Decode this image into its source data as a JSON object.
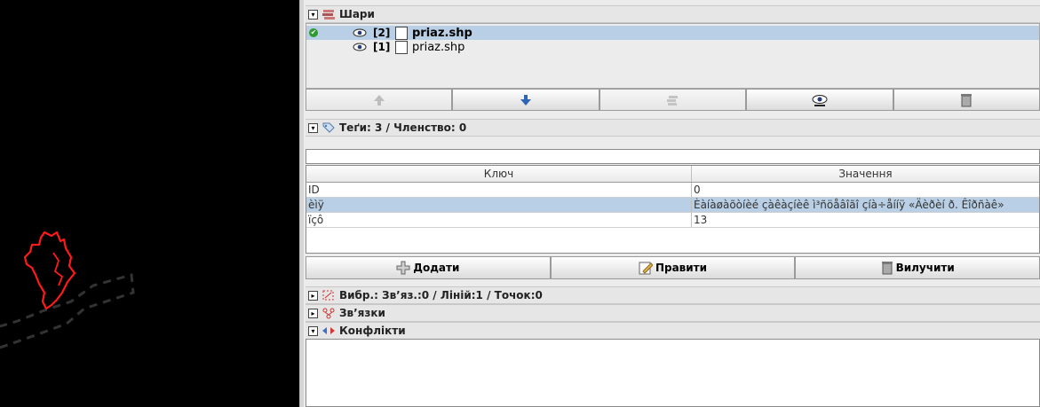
{
  "layers_panel": {
    "title": "Шари",
    "layers": [
      {
        "index": "[2]",
        "name": "priaz.shp",
        "active": true,
        "selected": true
      },
      {
        "index": "[1]",
        "name": "priaz.shp",
        "active": false,
        "selected": false
      }
    ],
    "buttons": [
      "move-up-icon",
      "move-down-icon",
      "merge-icon",
      "visibility-icon",
      "delete-icon"
    ]
  },
  "tags_panel": {
    "title": "Теґи: 3 / Членство: 0",
    "filter_value": "",
    "columns": {
      "key": "Ключ",
      "value": "Значення"
    },
    "rows": [
      {
        "key": "ID",
        "value": "0"
      },
      {
        "key": "èìÿ",
        "value": "Èàíàøàõòíèé çàêàçíèê ì³ñöåâîãî çíà÷åííÿ «Äèðèí ð. Êîðñàê»"
      },
      {
        "key": "ïçô",
        "value": "13"
      }
    ],
    "add_label": "Додати",
    "edit_label": "Правити",
    "delete_label": "Вилучити"
  },
  "selection_panel": {
    "title": "Вибр.: Зв’яз.:0 / Ліній:1 / Точок:0"
  },
  "relations_panel": {
    "title": "Зв’язки"
  },
  "conflicts_panel": {
    "title": "Конфлікти"
  },
  "colors": {
    "selection": "#b8cfe5",
    "map_bg": "#000000",
    "shape_stroke": "#ff1a1a"
  }
}
